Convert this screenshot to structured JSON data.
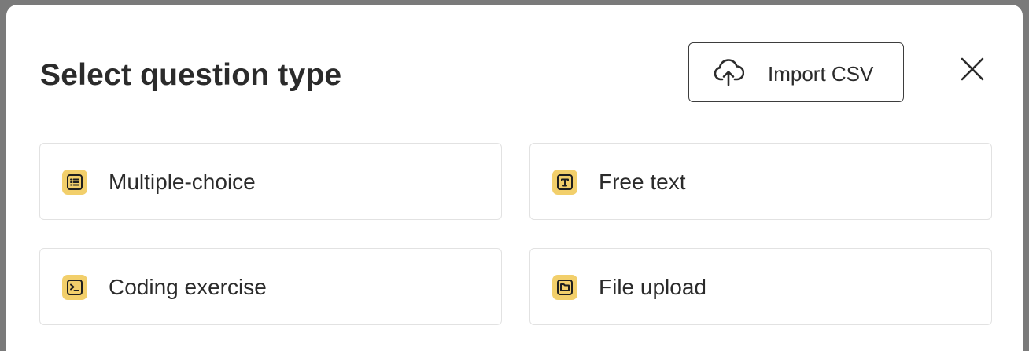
{
  "dialog": {
    "title": "Select question type",
    "import_button": {
      "label": "Import CSV",
      "icon": "cloud-upload-icon"
    },
    "close_button": {
      "icon": "close-icon"
    }
  },
  "question_types": [
    {
      "label": "Multiple-choice",
      "icon": "list-icon"
    },
    {
      "label": "Free text",
      "icon": "text-t-icon"
    },
    {
      "label": "Coding exercise",
      "icon": "terminal-icon"
    },
    {
      "label": "File upload",
      "icon": "folder-icon"
    }
  ],
  "colors": {
    "badge": "#f2cf6b",
    "text": "#2b2b2b",
    "card_border": "#e2e2e2",
    "backdrop": "#7a7a7a"
  }
}
